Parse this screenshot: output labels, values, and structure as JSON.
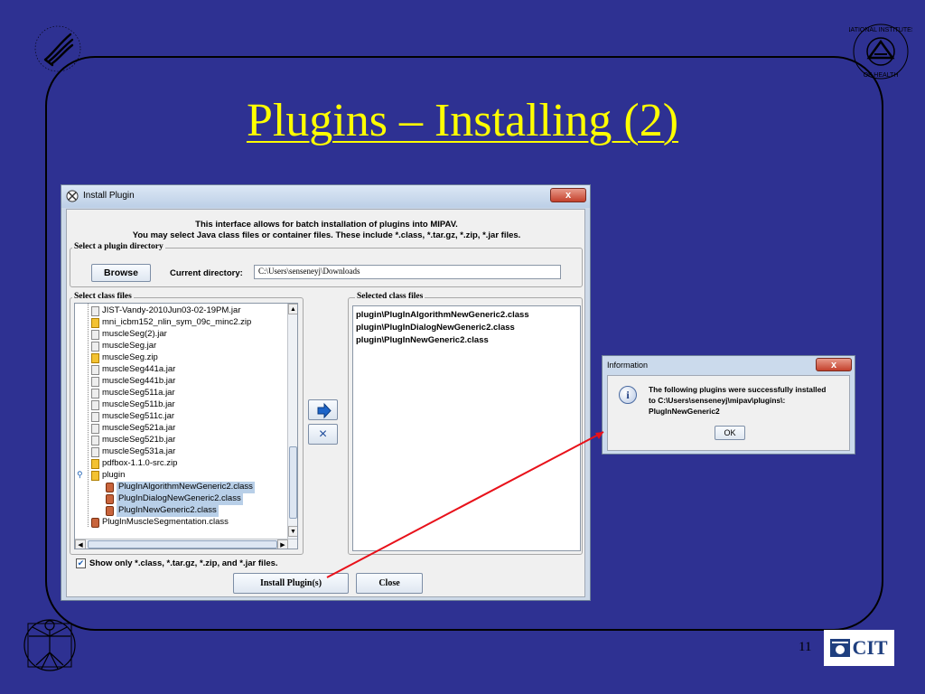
{
  "slide": {
    "title": "Plugins – Installing (2)",
    "page_number": "11",
    "cit_logo_text": "CIT"
  },
  "install_window": {
    "title": "Install Plugin",
    "close_label": "x",
    "info_line_1": "This interface allows for batch installation of plugins into MIPAV.",
    "info_line_2": "You may select Java class files or container files. These include *.class, *.tar.gz, *.zip, *.jar files.",
    "plugin_dir_group": "Select a plugin directory",
    "browse_label": "Browse",
    "current_dir_label": "Current directory:",
    "current_dir_value": "C:\\Users\\senseneyj\\Downloads",
    "class_files_group": "Select class files",
    "selected_files_group": "Selected class files",
    "tree_items": [
      {
        "label": "JIST-Vandy-2010Jun03-02-19PM.jar",
        "type": "jar",
        "selected": false
      },
      {
        "label": "mni_icbm152_nlin_sym_09c_minc2.zip",
        "type": "zip",
        "selected": false
      },
      {
        "label": "muscleSeg(2).jar",
        "type": "jar",
        "selected": false
      },
      {
        "label": "muscleSeg.jar",
        "type": "jar",
        "selected": false
      },
      {
        "label": "muscleSeg.zip",
        "type": "zip",
        "selected": false
      },
      {
        "label": "muscleSeg441a.jar",
        "type": "jar",
        "selected": false
      },
      {
        "label": "muscleSeg441b.jar",
        "type": "jar",
        "selected": false
      },
      {
        "label": "muscleSeg511a.jar",
        "type": "jar",
        "selected": false
      },
      {
        "label": "muscleSeg511b.jar",
        "type": "jar",
        "selected": false
      },
      {
        "label": "muscleSeg511c.jar",
        "type": "jar",
        "selected": false
      },
      {
        "label": "muscleSeg521a.jar",
        "type": "jar",
        "selected": false
      },
      {
        "label": "muscleSeg521b.jar",
        "type": "jar",
        "selected": false
      },
      {
        "label": "muscleSeg531a.jar",
        "type": "jar",
        "selected": false
      },
      {
        "label": "pdfbox-1.1.0-src.zip",
        "type": "zip",
        "selected": false
      },
      {
        "label": "plugin",
        "type": "folder",
        "selected": false
      },
      {
        "label": "PlugInAlgorithmNewGeneric2.class",
        "type": "class",
        "selected": true
      },
      {
        "label": "PlugInDialogNewGeneric2.class",
        "type": "class",
        "selected": true
      },
      {
        "label": "PlugInNewGeneric2.class",
        "type": "class",
        "selected": true
      },
      {
        "label": "PlugInMuscleSegmentation.class",
        "type": "class",
        "selected": false
      }
    ],
    "selected_files": [
      "plugin\\PlugInAlgorithmNewGeneric2.class",
      "plugin\\PlugInDialogNewGeneric2.class",
      "plugin\\PlugInNewGeneric2.class"
    ],
    "remove_symbol": "×",
    "show_only_checked": true,
    "show_only_label": "Show only *.class, *.tar.gz, *.zip, and *.jar files.",
    "install_label": "Install Plugin(s)",
    "close_button_label": "Close"
  },
  "info_dialog": {
    "title": "Information",
    "close_label": "x",
    "icon_glyph": "i",
    "message_line_1": "The following plugins were successfully installed",
    "message_line_2": "to C:\\Users\\senseneyj\\mipav\\plugins\\:",
    "message_line_3": "PlugInNewGeneric2",
    "ok_label": "OK"
  },
  "colors": {
    "background": "#2e3192",
    "title": "#ffff00",
    "pointer": "#e8111a",
    "selection": "#b8cfe8"
  },
  "icons": [
    "hhs-eagle-icon",
    "nih-logo-icon",
    "vitruvian-man-icon",
    "cit-logo-icon",
    "install-plugin-window-icon",
    "info-icon",
    "add-arrow-icon",
    "remove-x-icon"
  ]
}
